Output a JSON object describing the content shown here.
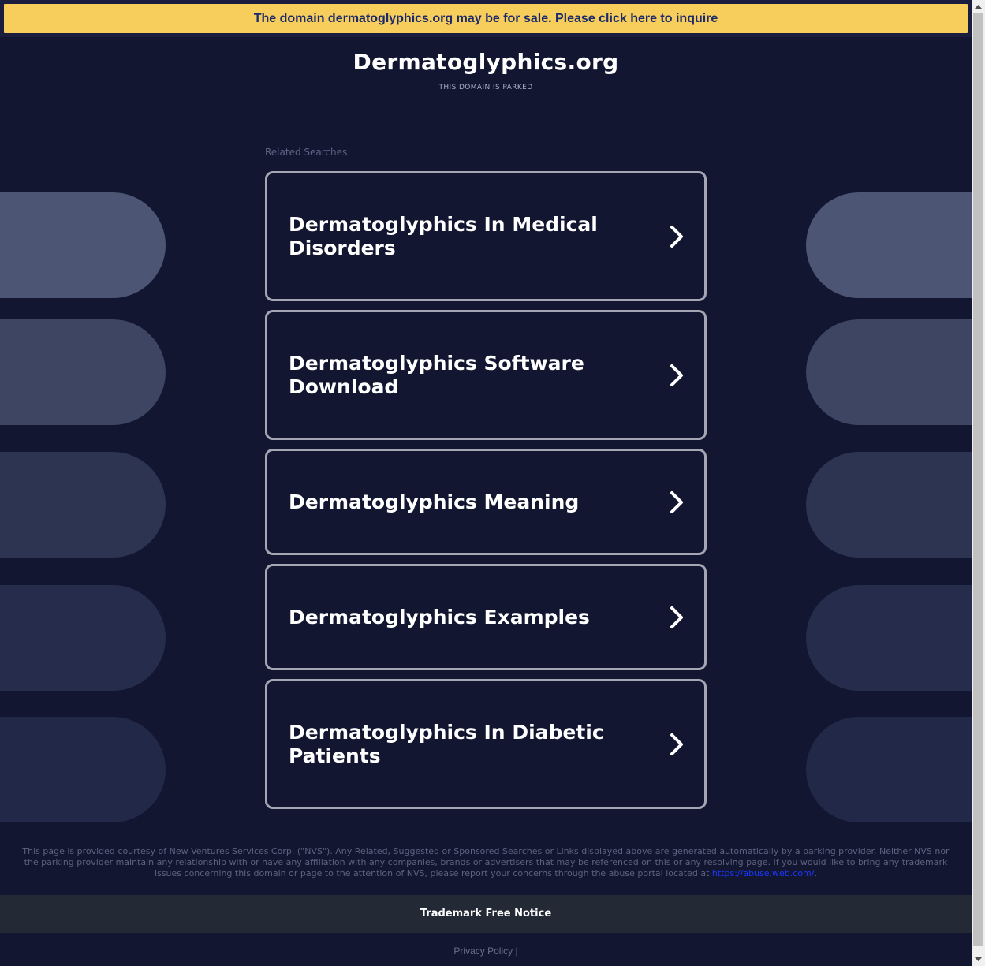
{
  "banner": {
    "text": "The domain dermatoglyphics.org may be for sale. Please click here to inquire"
  },
  "header": {
    "title": "Dermatoglyphics.org",
    "subtitle": "THIS DOMAIN IS PARKED"
  },
  "related": {
    "label": "Related Searches:",
    "items": [
      {
        "label": "Dermatoglyphics In Medical Disorders"
      },
      {
        "label": "Dermatoglyphics Software Download"
      },
      {
        "label": "Dermatoglyphics Meaning"
      },
      {
        "label": "Dermatoglyphics Examples"
      },
      {
        "label": "Dermatoglyphics In Diabetic Patients"
      }
    ]
  },
  "footer": {
    "disclaimer": "This page is provided courtesy of New Ventures Services Corp. (\"NVS\"). Any Related, Suggested or Sponsored Searches or Links displayed above are generated automatically by a parking provider. Neither NVS nor the parking provider maintain any relationship with or have any affiliation with any companies, brands or advertisers that may be referenced on this or any resolving page. If you would like to bring any trademark issues concerning this domain or page to the attention of NVS, please report your concerns through the abuse portal located at",
    "abuse_link": "https://abuse.web.com/",
    "disclaimer_end": ".",
    "trademark_notice": "Trademark Free Notice",
    "privacy": "Privacy Policy |"
  },
  "icons": {
    "chevron": "chevron-right-icon",
    "scroll_up": "scroll-up-arrow-icon",
    "scroll_down": "scroll-down-arrow-icon"
  },
  "colors": {
    "background": "#121630",
    "banner": "#f7cd5c",
    "banner_text": "#1a2a6b",
    "card_border": "#a4a7b3",
    "link": "#1a36ff"
  }
}
